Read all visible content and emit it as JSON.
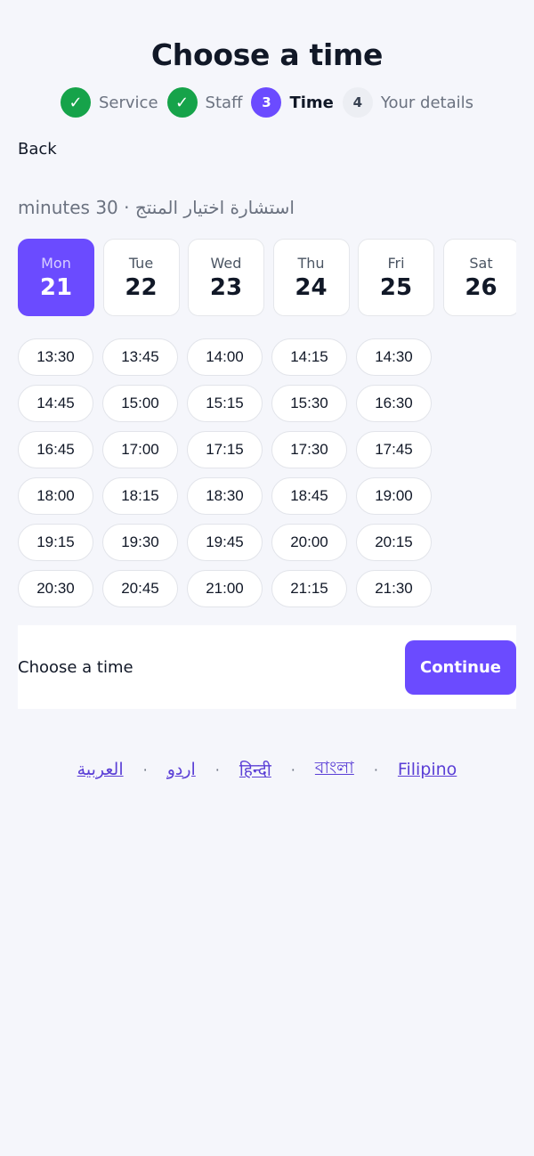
{
  "header": {
    "title": "Choose a time"
  },
  "steps": [
    {
      "badge": "✓",
      "label": "Service",
      "state": "done"
    },
    {
      "badge": "✓",
      "label": "Staff",
      "state": "done"
    },
    {
      "badge": "3",
      "label": "Time",
      "state": "current"
    },
    {
      "badge": "4",
      "label": "Your details",
      "state": "todo"
    }
  ],
  "nav": {
    "back_label": "Back"
  },
  "service": {
    "summary": "استشارة اختيار المنتج · 30 minutes"
  },
  "days": [
    {
      "dow": "Mon",
      "num": "21",
      "selected": true
    },
    {
      "dow": "Tue",
      "num": "22",
      "selected": false
    },
    {
      "dow": "Wed",
      "num": "23",
      "selected": false
    },
    {
      "dow": "Thu",
      "num": "24",
      "selected": false
    },
    {
      "dow": "Fri",
      "num": "25",
      "selected": false
    },
    {
      "dow": "Sat",
      "num": "26",
      "selected": false
    }
  ],
  "slots": [
    "13:30",
    "13:45",
    "14:00",
    "14:15",
    "14:30",
    "14:45",
    "15:00",
    "15:15",
    "15:30",
    "16:30",
    "16:45",
    "17:00",
    "17:15",
    "17:30",
    "17:45",
    "18:00",
    "18:15",
    "18:30",
    "18:45",
    "19:00",
    "19:15",
    "19:30",
    "19:45",
    "20:00",
    "20:15",
    "20:30",
    "20:45",
    "21:00",
    "21:15",
    "21:30"
  ],
  "footer": {
    "message": "Choose a time",
    "continue_label": "Continue"
  },
  "languages": [
    "العربية",
    "اردو",
    "हिन्दी",
    "বাংলা",
    "Filipino"
  ],
  "language_separator": "·",
  "colors": {
    "accent": "#6b4bff",
    "success": "#16a34a",
    "link": "#5b3fd6",
    "background": "#f5f6fb"
  }
}
